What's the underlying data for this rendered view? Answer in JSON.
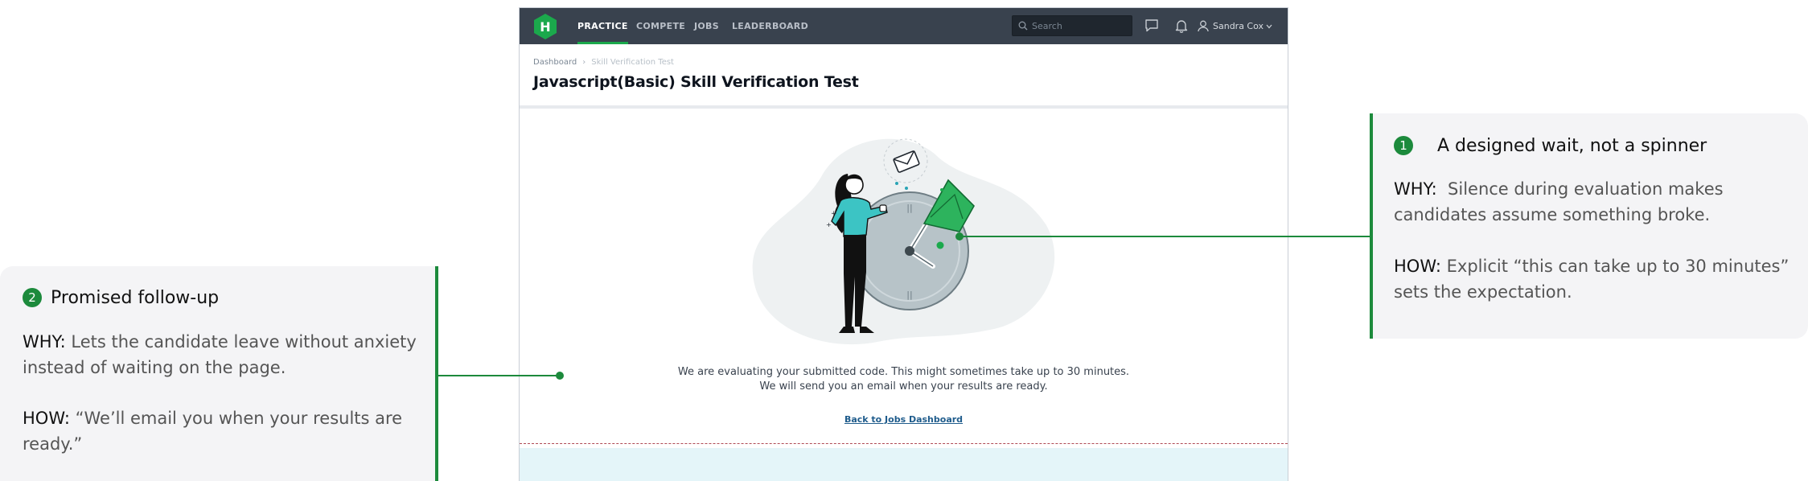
{
  "app": {
    "logo_letter": "H",
    "nav": [
      "PRACTICE",
      "COMPETE",
      "JOBS",
      "LEADERBOARD"
    ],
    "active_nav": "PRACTICE",
    "search_placeholder": "Search",
    "user_name": "Sandra Cox",
    "icons": [
      "search-icon",
      "chat-icon",
      "bell-icon",
      "user-icon",
      "chevron-down-icon"
    ],
    "breadcrumb": [
      "Dashboard",
      "Skill Verification Test"
    ],
    "page_title": "Javascript(Basic) Skill Verification Test",
    "message_line1": "We are evaluating your submitted code. This might sometimes take up to 30 minutes.",
    "message_line2": "We will send you an email when your results are ready.",
    "back_link": "Back to Jobs Dashboard",
    "colors": {
      "navbar": "#39424e",
      "brand_green": "#1ba94c",
      "link": "#1f5c8c"
    }
  },
  "annotations": [
    {
      "number": "1",
      "title": "A designed wait, not a spinner",
      "why_label": "WHY:",
      "why_line1": "Silence during evaluation makes",
      "why_line2": "candidates assume something broke.",
      "how_label": "HOW:",
      "how_line1": "Explicit “this can take up to 30 minutes”",
      "how_line2": "sets the expectation."
    },
    {
      "number": "2",
      "title": "Promised follow-up",
      "why_label": "WHY:",
      "why_line1": "Lets the candidate leave without anxiety",
      "why_line2": "instead of waiting on the page.",
      "how_label": "HOW:",
      "how_line1": "“We’ll email you when your results are",
      "how_line2": "ready.”"
    }
  ],
  "annotation_color": "#1c8a3c"
}
